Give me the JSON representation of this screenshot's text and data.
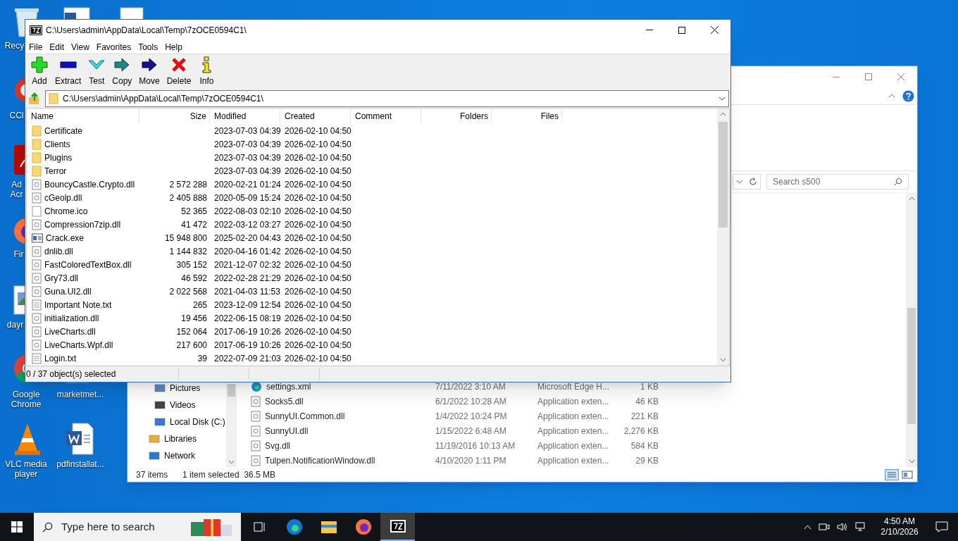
{
  "desktop_icons": [
    {
      "kind": "recycle",
      "label": "Recy"
    },
    {
      "kind": "ccleaner",
      "label": "CCl"
    },
    {
      "kind": "acrobat",
      "label": "Ad Acr"
    },
    {
      "kind": "firefox",
      "label": "Fir"
    },
    {
      "kind": "image",
      "label": "dayr"
    },
    {
      "kind": "chrome",
      "label": "Google Chrome"
    },
    {
      "kind": "document",
      "label": "marketmet..."
    },
    {
      "kind": "vlc",
      "label": "VLC media player"
    },
    {
      "kind": "word",
      "label": "pdfinstallat..."
    }
  ],
  "explorer": {
    "search": {
      "placeholder": "Search s500"
    },
    "nav_items": [
      {
        "kind": "pictures",
        "label": "Pictures"
      },
      {
        "kind": "videos",
        "label": "Videos"
      },
      {
        "kind": "disk",
        "label": "Local Disk (C:)"
      },
      {
        "kind": "libraries",
        "label": "Libraries"
      },
      {
        "kind": "network",
        "label": "Network"
      }
    ],
    "files": [
      {
        "kind": "edge",
        "name": "settings.xml",
        "modified": "7/11/2022 3:10 AM",
        "type": "Microsoft Edge H...",
        "size": "1 KB"
      },
      {
        "kind": "dll",
        "name": "Socks5.dll",
        "modified": "6/1/2022 10:28 AM",
        "type": "Application exten...",
        "size": "46 KB"
      },
      {
        "kind": "dll",
        "name": "SunnyUI.Common.dll",
        "modified": "1/4/2022 10:24 PM",
        "type": "Application exten...",
        "size": "221 KB"
      },
      {
        "kind": "dll",
        "name": "SunnyUI.dll",
        "modified": "1/15/2022 6:48 AM",
        "type": "Application exten...",
        "size": "2,276 KB"
      },
      {
        "kind": "dll",
        "name": "Svg.dll",
        "modified": "11/19/2016 10:13 AM",
        "type": "Application exten...",
        "size": "584 KB"
      },
      {
        "kind": "dll",
        "name": "Tulpen.NotificationWindow.dll",
        "modified": "4/10/2020 1:11 PM",
        "type": "Application exten...",
        "size": "29 KB"
      }
    ],
    "status": {
      "count": "37 items",
      "selection": "1 item selected  36.5 MB"
    }
  },
  "sevenzip": {
    "title": "C:\\Users\\admin\\AppData\\Local\\Temp\\7zOCE0594C1\\",
    "menu": [
      "File",
      "Edit",
      "View",
      "Favorites",
      "Tools",
      "Help"
    ],
    "toolbar": [
      {
        "kind": "add",
        "label": "Add"
      },
      {
        "kind": "extract",
        "label": "Extract"
      },
      {
        "kind": "test",
        "label": "Test"
      },
      {
        "kind": "copy",
        "label": "Copy"
      },
      {
        "kind": "move",
        "label": "Move"
      },
      {
        "kind": "delete",
        "label": "Delete"
      },
      {
        "kind": "info",
        "label": "Info"
      }
    ],
    "path": "C:\\Users\\admin\\AppData\\Local\\Temp\\7zOCE0594C1\\",
    "columns": [
      "Name",
      "Size",
      "Modified",
      "Created",
      "Comment",
      "Folders",
      "Files"
    ],
    "rows": [
      {
        "kind": "folder",
        "name": "Certificate",
        "size": "",
        "modified": "2023-07-03 04:39",
        "created": "2026-02-10 04:50"
      },
      {
        "kind": "folder",
        "name": "Clients",
        "size": "",
        "modified": "2023-07-03 04:39",
        "created": "2026-02-10 04:50"
      },
      {
        "kind": "folder",
        "name": "Plugins",
        "size": "",
        "modified": "2023-07-03 04:39",
        "created": "2026-02-10 04:50"
      },
      {
        "kind": "folder",
        "name": "Terror",
        "size": "",
        "modified": "2023-07-03 04:39",
        "created": "2026-02-10 04:50"
      },
      {
        "kind": "dll",
        "name": "BouncyCastle.Crypto.dll",
        "size": "2 572 288",
        "modified": "2020-02-21 01:24",
        "created": "2026-02-10 04:50"
      },
      {
        "kind": "dll",
        "name": "cGeolp.dll",
        "size": "2 405 888",
        "modified": "2020-05-09 15:24",
        "created": "2026-02-10 04:50"
      },
      {
        "kind": "blank",
        "name": "Chrome.ico",
        "size": "52 365",
        "modified": "2022-08-03 02:10",
        "created": "2026-02-10 04:50"
      },
      {
        "kind": "dll",
        "name": "Compression7zip.dll",
        "size": "41 472",
        "modified": "2022-03-12 03:27",
        "created": "2026-02-10 04:50"
      },
      {
        "kind": "exe",
        "name": "Crack.exe",
        "size": "15 948 800",
        "modified": "2025-02-20 04:43",
        "created": "2026-02-10 04:50"
      },
      {
        "kind": "dll",
        "name": "dnlib.dll",
        "size": "1 144 832",
        "modified": "2020-04-16 01:42",
        "created": "2026-02-10 04:50"
      },
      {
        "kind": "dll",
        "name": "FastColoredTextBox.dll",
        "size": "305 152",
        "modified": "2021-12-07 02:32",
        "created": "2026-02-10 04:50"
      },
      {
        "kind": "dll",
        "name": "Gry73.dll",
        "size": "46 592",
        "modified": "2022-02-28 21:29",
        "created": "2026-02-10 04:50"
      },
      {
        "kind": "dll",
        "name": "Guna.UI2.dll",
        "size": "2 022 568",
        "modified": "2021-04-03 11:53",
        "created": "2026-02-10 04:50"
      },
      {
        "kind": "text",
        "name": "Important Note.txt",
        "size": "265",
        "modified": "2023-12-09 12:54",
        "created": "2026-02-10 04:50"
      },
      {
        "kind": "dll",
        "name": "initialization.dll",
        "size": "19 456",
        "modified": "2022-06-15 08:19",
        "created": "2026-02-10 04:50"
      },
      {
        "kind": "dll",
        "name": "LiveCharts.dll",
        "size": "152 064",
        "modified": "2017-06-19 10:26",
        "created": "2026-02-10 04:50"
      },
      {
        "kind": "dll",
        "name": "LiveCharts.Wpf.dll",
        "size": "217 600",
        "modified": "2017-06-19 10:26",
        "created": "2026-02-10 04:50"
      },
      {
        "kind": "text",
        "name": "Login.txt",
        "size": "39",
        "modified": "2022-07-09 21:03",
        "created": "2026-02-10 04:50"
      }
    ],
    "status": "0 / 37 object(s) selected"
  },
  "taskbar": {
    "search_placeholder": "Type here to search",
    "apps": [
      {
        "kind": "taskview",
        "selected": false
      },
      {
        "kind": "edge",
        "selected": false
      },
      {
        "kind": "explorer",
        "selected": false
      },
      {
        "kind": "firefox",
        "selected": false
      },
      {
        "kind": "sevenzip",
        "selected": true
      }
    ],
    "time": "4:50 AM",
    "date": "2/10/2026"
  }
}
